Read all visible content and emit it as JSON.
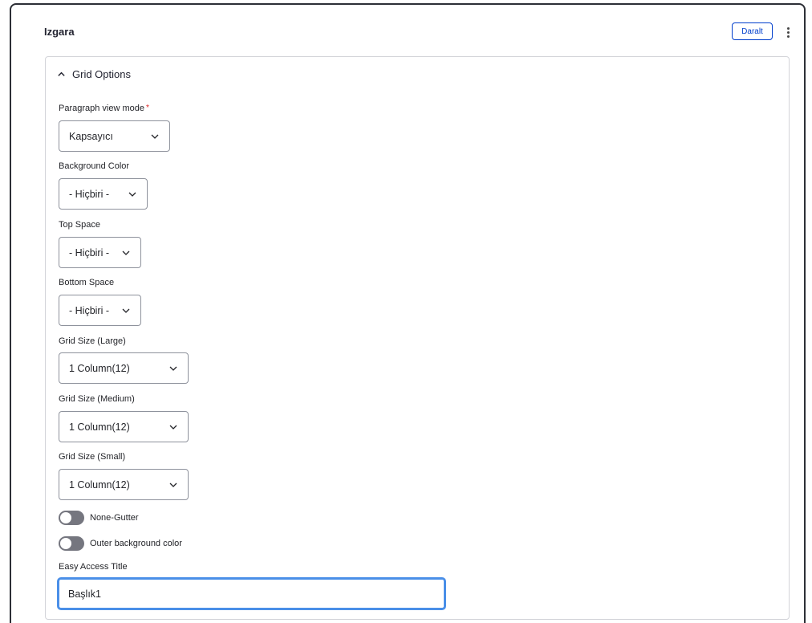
{
  "paragraph": {
    "title": "Izgara",
    "collapse_label": "Daralt",
    "more_icon": "kebab-vertical-icon"
  },
  "grid_options": {
    "summary_label": "Grid Options",
    "summary_icon": "chevron-up-icon",
    "fields": {
      "view_mode": {
        "label": "Paragraph view mode",
        "required_mark": "*",
        "value": "Kapsayıcı"
      },
      "background_color": {
        "label": "Background Color",
        "value": "- Hiçbiri -"
      },
      "top_space": {
        "label": "Top Space",
        "value": "- Hiçbiri -"
      },
      "bottom_space": {
        "label": "Bottom Space",
        "value": "- Hiçbiri -"
      },
      "grid_large": {
        "label": "Grid Size (Large)",
        "value": "1 Column(12)"
      },
      "grid_medium": {
        "label": "Grid Size (Medium)",
        "value": "1 Column(12)"
      },
      "grid_small": {
        "label": "Grid Size (Small)",
        "value": "1 Column(12)"
      }
    },
    "toggles": {
      "none_gutter": {
        "label": "None-Gutter",
        "checked": false
      },
      "outer_bg": {
        "label": "Outer background color",
        "checked": false
      }
    },
    "easy_access_title": {
      "label": "Easy Access Title",
      "value": "Başlık1"
    }
  },
  "colors": {
    "accent": "#003ecc",
    "focus_ring": "#4a8fe8",
    "toggle_off": "#75767f",
    "required": "#dc2323"
  }
}
